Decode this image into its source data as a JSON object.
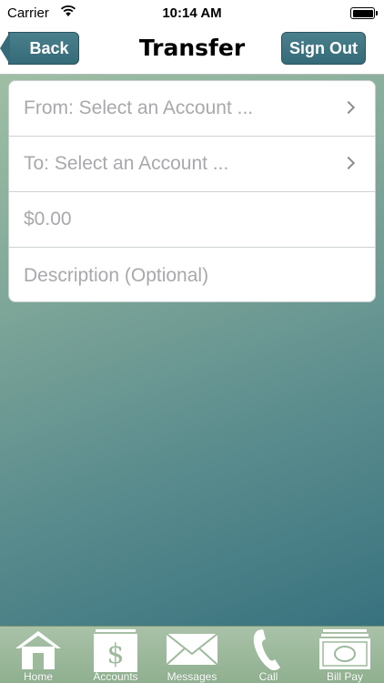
{
  "status_bar": {
    "carrier": "Carrier",
    "time": "10:14 AM",
    "wifi_icon": "wifi-icon",
    "battery_icon": "battery-icon",
    "battery_level": 1.0
  },
  "nav": {
    "title": "Transfer",
    "back_label": "Back",
    "signout_label": "Sign Out",
    "accent_color": "#3f7582"
  },
  "form": {
    "from_placeholder": "From: Select an Account ...",
    "to_placeholder": "To: Select an Account ...",
    "amount_placeholder": "$0.00",
    "description_placeholder": "Description (Optional)"
  },
  "tabs": [
    {
      "label": "Home",
      "icon": "home-icon"
    },
    {
      "label": "Accounts",
      "icon": "dollar-icon"
    },
    {
      "label": "Messages",
      "icon": "envelope-icon"
    },
    {
      "label": "Call",
      "icon": "phone-icon"
    },
    {
      "label": "Bill Pay",
      "icon": "bill-icon"
    }
  ]
}
